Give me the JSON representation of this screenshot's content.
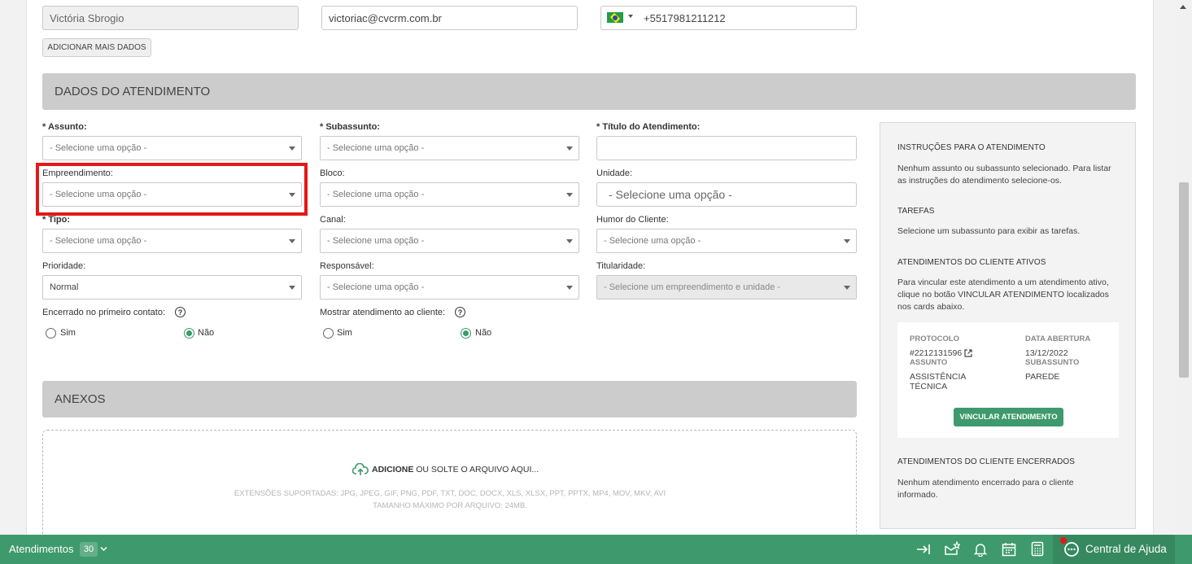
{
  "contact": {
    "name_value": "Victória Sbrogio",
    "email_value": "victoriac@cvcrm.com.br",
    "phone_value": "+5517981211212",
    "add_more_label": "ADICIONAR MAIS DADOS"
  },
  "sections": {
    "atendimento_title": "DADOS DO ATENDIMENTO",
    "anexos_title": "ANEXOS"
  },
  "form": {
    "assunto": {
      "label_star": "* ",
      "label": "Assunto:",
      "value": "- Selecione uma opção -"
    },
    "subassunto": {
      "label_star": "* ",
      "label": "Subassunto:",
      "value": "- Selecione uma opção -"
    },
    "titulo": {
      "label_star": "* ",
      "label": "Título do Atendimento:",
      "value": ""
    },
    "empreendimento": {
      "label": "Empreendimento:",
      "value": "- Selecione uma opção -"
    },
    "bloco": {
      "label": "Bloco:",
      "value": "- Selecione uma opção -"
    },
    "unidade": {
      "label": "Unidade:",
      "value": "- Selecione uma opção -"
    },
    "tipo": {
      "label_star": "* ",
      "label": "Tipo:",
      "value": "- Selecione uma opção -"
    },
    "canal": {
      "label": "Canal:",
      "value": "- Selecione uma opção -"
    },
    "humor": {
      "label": "Humor do Cliente:",
      "value": "- Selecione uma opção -"
    },
    "prioridade": {
      "label": "Prioridade:",
      "value": "Normal"
    },
    "responsavel": {
      "label": "Responsável:",
      "value": "- Selecione uma opção -"
    },
    "titularidade": {
      "label": "Titularidade:",
      "value": "- Selecione um empreendimento e unidade -"
    },
    "encerrado": {
      "label": "Encerrado no primeiro contato:",
      "opt_yes": "Sim",
      "opt_no": "Não",
      "selected": "Não"
    },
    "mostrar": {
      "label": "Mostrar atendimento ao cliente:",
      "opt_yes": "Sim",
      "opt_no": "Não",
      "selected": "Não"
    }
  },
  "anexos": {
    "add_strong": "ADICIONE",
    "add_rest": " OU SOLTE O ARQUIVO AQUI...",
    "extensions": "EXTENSÕES SUPORTADAS: JPG, JPEG, GIF, PNG, PDF, TXT, DOC, DOCX, XLS, XLSX, PPT, PPTX, MP4, MOV, MKV, AVI",
    "max_size": "TAMANHO MÁXIMO POR ARQUIVO: 24MB."
  },
  "side": {
    "instr_title": "INSTRUÇÕES PARA O ATENDIMENTO",
    "instr_text": "Nenhum assunto ou subassunto selecionado. Para listar as instruções do atendimento selecione-os.",
    "tarefas_title": "TAREFAS",
    "tarefas_text": "Selecione um subassunto para exibir as tarefas.",
    "ativos_title": "ATENDIMENTOS DO CLIENTE ATIVOS",
    "ativos_text": "Para vincular este atendimento a um atendimento ativo, clique no botão VINCULAR ATENDIMENTO localizados nos cards abaixo.",
    "card": {
      "protocolo_label": "PROTOCOLO",
      "protocolo_value": "#2212131596",
      "data_label": "DATA ABERTURA",
      "data_value": "13/12/2022",
      "assunto_label": "ASSUNTO",
      "assunto_value": "ASSISTÊNCIA TÉCNICA",
      "subassunto_label": "SUBASSUNTO",
      "subassunto_value": "PAREDE",
      "button": "VINCULAR ATENDIMENTO"
    },
    "encerrados_title": "ATENDIMENTOS DO CLIENTE ENCERRADOS",
    "encerrados_text": "Nenhum atendimento encerrado para o cliente informado."
  },
  "bottom": {
    "atendimentos_label": "Atendimentos",
    "atendimentos_count": "30",
    "help_label": "Central de Ajuda"
  },
  "colors": {
    "accent": "#3e9a6c",
    "highlight": "#e41818"
  }
}
